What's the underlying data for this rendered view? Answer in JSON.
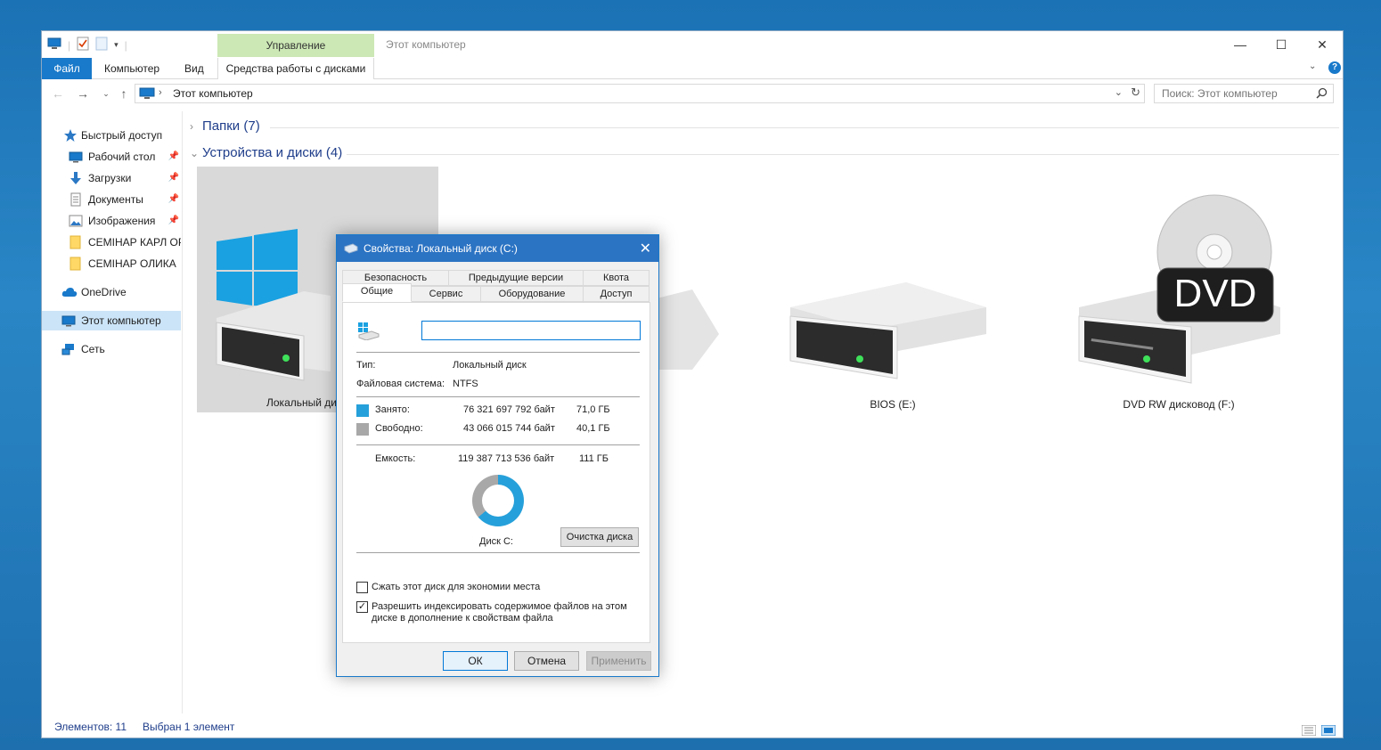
{
  "window": {
    "title": "Этот компьютер",
    "manage_label": "Управление",
    "ribbon_tabs": [
      "Файл",
      "Компьютер",
      "Вид",
      "Средства работы с дисками"
    ],
    "minimize": "—",
    "maximize": "☐",
    "close": "✕"
  },
  "address": {
    "crumb": "Этот компьютер",
    "search_placeholder": "Поиск: Этот компьютер"
  },
  "nav": {
    "quick_access": "Быстрый доступ",
    "items": [
      {
        "label": "Рабочий стол",
        "pinned": true
      },
      {
        "label": "Загрузки",
        "pinned": true
      },
      {
        "label": "Документы",
        "pinned": true
      },
      {
        "label": "Изображения",
        "pinned": true
      },
      {
        "label": "СЕМІНАР КАРЛ ОР",
        "pinned": false
      },
      {
        "label": "СЕМІНАР ОЛИКА",
        "pinned": false
      }
    ],
    "onedrive": "OneDrive",
    "this_pc": "Этот компьютер",
    "network": "Сеть"
  },
  "content": {
    "folders_group": "Папки (7)",
    "devices_group": "Устройства и диски (4)",
    "drives": [
      {
        "name": "Локальный ди",
        "selected": true
      },
      {
        "name": "BIOS (E:)",
        "selected": false
      },
      {
        "name": "DVD RW дисковод (F:)",
        "selected": false
      }
    ],
    "dvd_label": "DVD"
  },
  "status": {
    "items": "Элементов: 11",
    "selected": "Выбран 1 элемент"
  },
  "dialog": {
    "title": "Свойства: Локальный диск (C:)",
    "tabs_row1": [
      "Безопасность",
      "Предыдущие версии",
      "Квота"
    ],
    "tabs_row2": [
      "Общие",
      "Сервис",
      "Оборудование",
      "Доступ"
    ],
    "active_tab": "Общие",
    "name_value": "",
    "type_label": "Тип:",
    "type_value": "Локальный диск",
    "fs_label": "Файловая система:",
    "fs_value": "NTFS",
    "used_label": "Занято:",
    "used_bytes": "76 321 697 792 байт",
    "used_gb": "71,0 ГБ",
    "free_label": "Свободно:",
    "free_bytes": "43 066 015 744 байт",
    "free_gb": "40,1 ГБ",
    "capacity_label": "Емкость:",
    "capacity_bytes": "119 387 713 536 байт",
    "capacity_gb": "111 ГБ",
    "used_fraction": 0.639,
    "used_color": "#26a0da",
    "free_color": "#a8a8a8",
    "disk_label": "Диск C:",
    "cleanup_button": "Очистка диска",
    "compress_label": "Сжать этот диск для экономии места",
    "compress_checked": false,
    "index_label_1": "Разрешить индексировать содержимое файлов на этом",
    "index_label_2": "диске в дополнение к свойствам файла",
    "index_checked": true,
    "ok": "ОК",
    "cancel": "Отмена",
    "apply": "Применить"
  }
}
